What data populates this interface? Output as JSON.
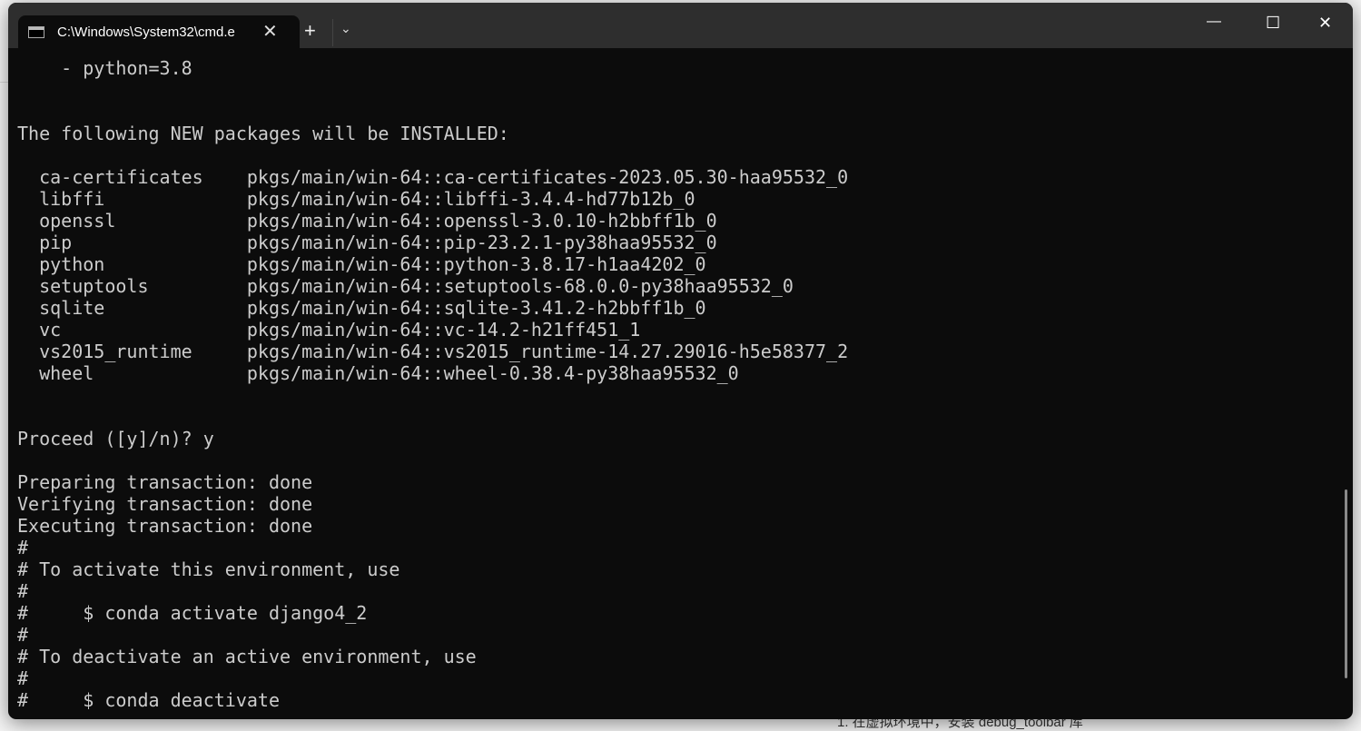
{
  "window": {
    "tab_title": "C:\\Windows\\System32\\cmd.e",
    "new_tab_label": "+",
    "dropdown_label": "⌄",
    "minimize_label": "—",
    "maximize_label": "☐",
    "close_label": "✕",
    "tab_close_label": "✕"
  },
  "terminal": {
    "lines": [
      "    - python=3.8",
      "",
      "",
      "The following NEW packages will be INSTALLED:",
      "",
      "  ca-certificates    pkgs/main/win-64::ca-certificates-2023.05.30-haa95532_0",
      "  libffi             pkgs/main/win-64::libffi-3.4.4-hd77b12b_0",
      "  openssl            pkgs/main/win-64::openssl-3.0.10-h2bbff1b_0",
      "  pip                pkgs/main/win-64::pip-23.2.1-py38haa95532_0",
      "  python             pkgs/main/win-64::python-3.8.17-h1aa4202_0",
      "  setuptools         pkgs/main/win-64::setuptools-68.0.0-py38haa95532_0",
      "  sqlite             pkgs/main/win-64::sqlite-3.41.2-h2bbff1b_0",
      "  vc                 pkgs/main/win-64::vc-14.2-h21ff451_1",
      "  vs2015_runtime     pkgs/main/win-64::vs2015_runtime-14.27.29016-h5e58377_2",
      "  wheel              pkgs/main/win-64::wheel-0.38.4-py38haa95532_0",
      "",
      "",
      "Proceed ([y]/n)? y",
      "",
      "Preparing transaction: done",
      "Verifying transaction: done",
      "Executing transaction: done",
      "#",
      "# To activate this environment, use",
      "#",
      "#     $ conda activate django4_2",
      "#",
      "# To deactivate an active environment, use",
      "#",
      "#     $ conda deactivate"
    ]
  },
  "background": {
    "bottom_text": "1. 在虚拟环境中，安装 debug_toolbar 库"
  }
}
